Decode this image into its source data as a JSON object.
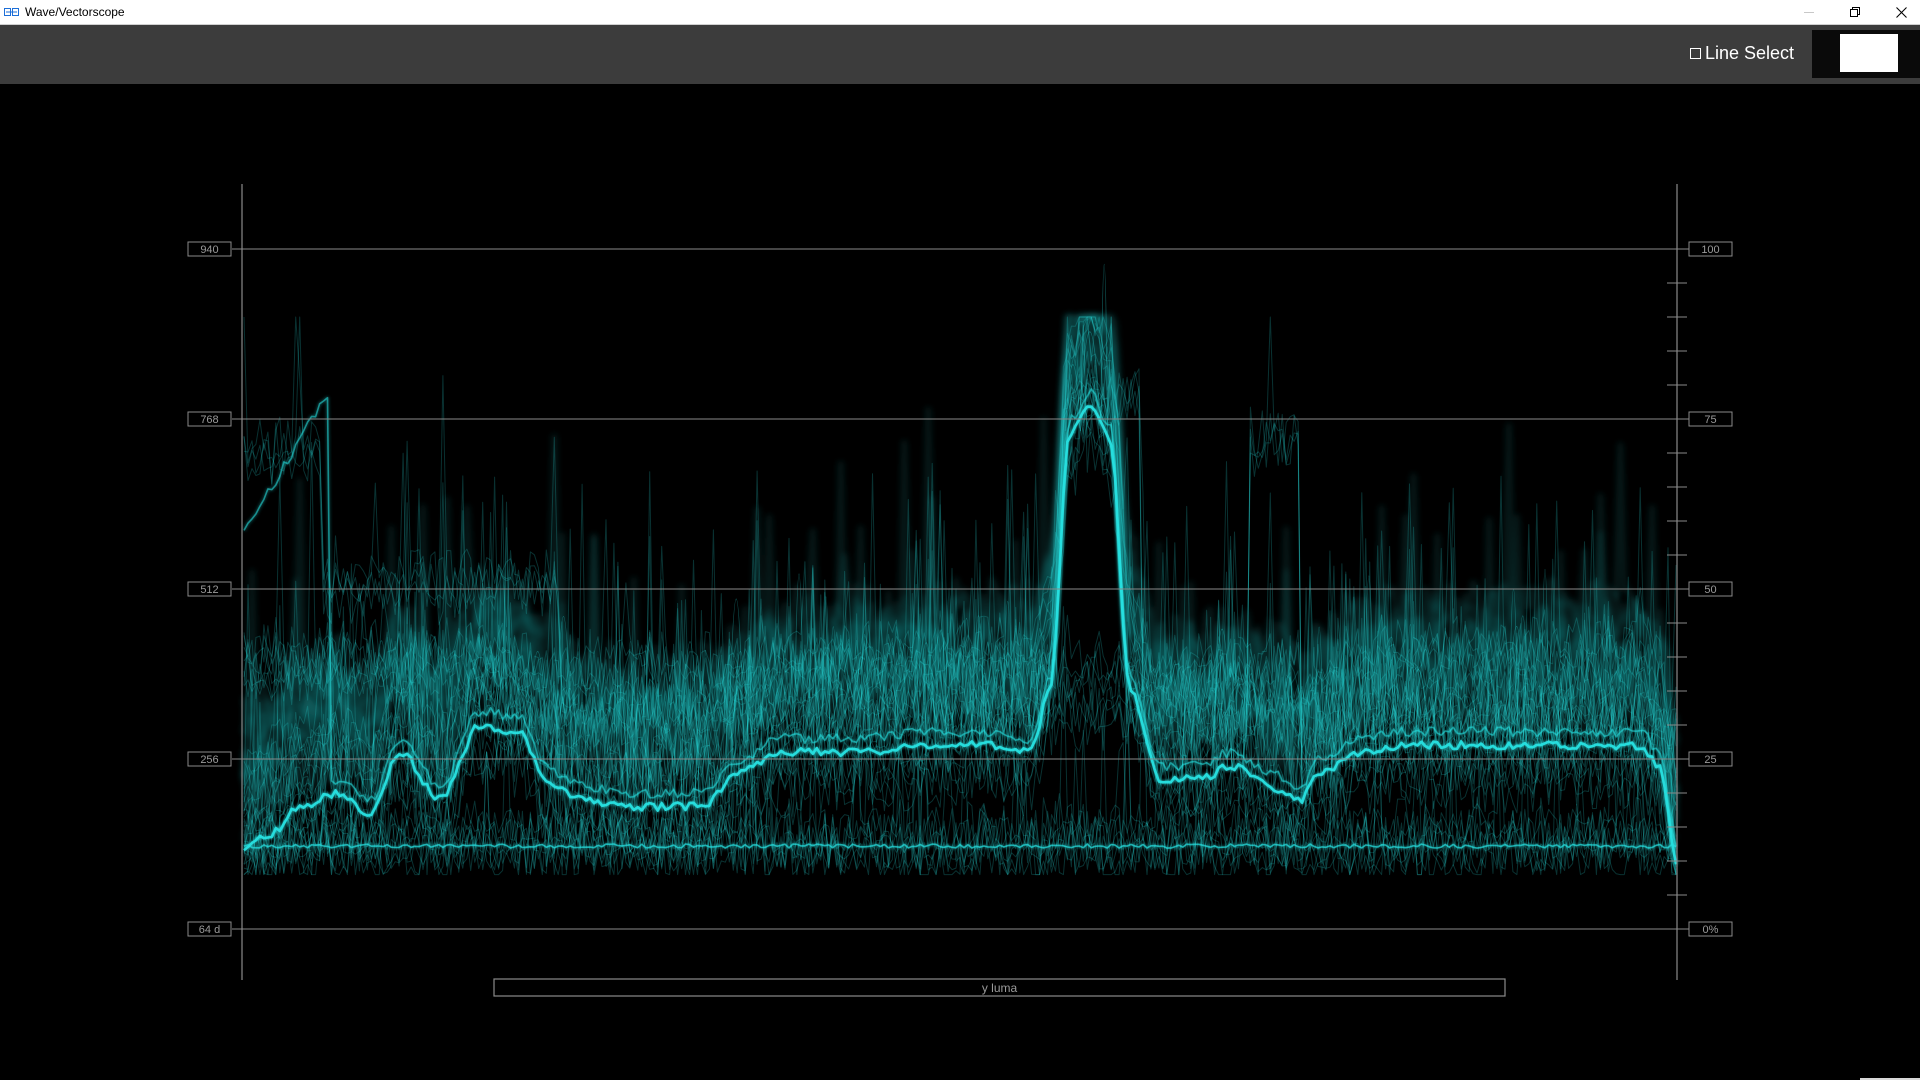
{
  "window": {
    "title": "Wave/Vectorscope",
    "controls": [
      "minimize-icon",
      "restore-icon",
      "close-icon"
    ]
  },
  "toolbar": {
    "line_select_label": "Line Select",
    "line_select_checked": false,
    "swatch_color": "#ffffff"
  },
  "scope": {
    "trace_color": "#27e0e0",
    "graticule_color": "#8a8a8a",
    "left_scale_labels": [
      "940",
      "768",
      "512",
      "256",
      "64 d"
    ],
    "right_scale_labels": [
      "100",
      "75",
      "50",
      "25",
      "0%"
    ],
    "channel_label": "y luma"
  }
}
